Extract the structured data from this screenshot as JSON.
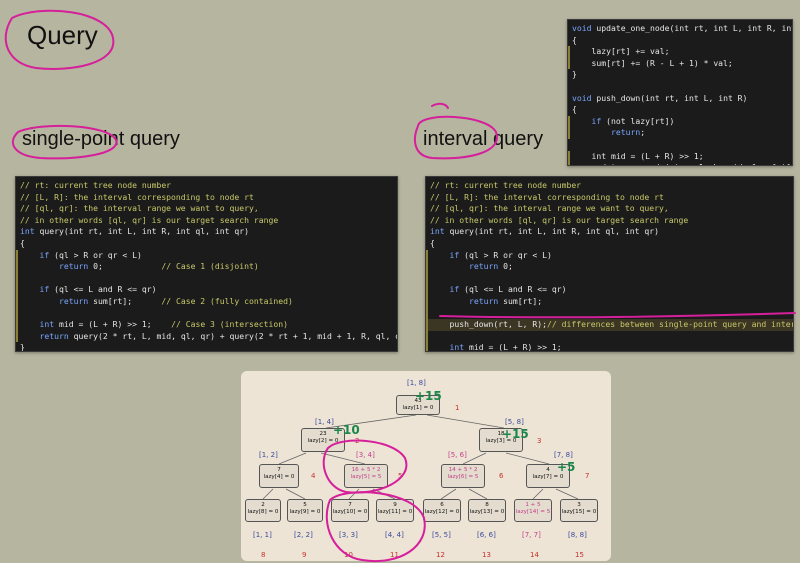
{
  "headings": {
    "main": "Query",
    "single_a": "single-point",
    "single_b": " query",
    "interval_a": "interval",
    "interval_b": " query"
  },
  "code_update": [
    [
      [
        "kw",
        "void"
      ],
      [
        "t",
        " update_one_node(int rt, int L, int R, int val)"
      ]
    ],
    [
      [
        "t",
        "{"
      ]
    ],
    [
      [
        "t",
        "    lazy[rt] += val;"
      ]
    ],
    [
      [
        "t",
        "    sum[rt] += (R - L + 1) * val;"
      ]
    ],
    [
      [
        "t",
        "}"
      ]
    ],
    [
      [
        "t",
        ""
      ]
    ],
    [
      [
        "kw",
        "void"
      ],
      [
        "t",
        " push_down(int rt, int L, int R)"
      ]
    ],
    [
      [
        "t",
        "{"
      ]
    ],
    [
      [
        "t",
        "    "
      ],
      [
        "kw",
        "if"
      ],
      [
        "t",
        " (not lazy[rt])"
      ]
    ],
    [
      [
        "t",
        "        "
      ],
      [
        "kw",
        "return"
      ],
      [
        "t",
        ";"
      ]
    ],
    [
      [
        "t",
        ""
      ]
    ],
    [
      [
        "t",
        "    int mid = (L + R) >> 1;"
      ]
    ],
    [
      [
        "t",
        "    update_one_node(rt << 1, L, mid, lazy[rt]);"
      ]
    ],
    [
      [
        "t",
        "    update_one_node((rt << 1) | 1, mid + 1, R, lazy[rt]);"
      ]
    ],
    [
      [
        "t",
        "    lazy[rt] = 0;"
      ]
    ],
    [
      [
        "t",
        "}"
      ]
    ]
  ],
  "code_single": [
    [
      [
        "com",
        "// rt: current tree node number"
      ]
    ],
    [
      [
        "com",
        "// [L, R]: the interval corresponding to node rt"
      ]
    ],
    [
      [
        "com",
        "// [ql, qr]: the interval range we want to query,"
      ]
    ],
    [
      [
        "com",
        "// in other words [ql, qr] is our target search range"
      ]
    ],
    [
      [
        "kw",
        "int"
      ],
      [
        "t",
        " query(int rt, int L, int R, int ql, int qr)"
      ]
    ],
    [
      [
        "t",
        "{"
      ]
    ],
    [
      [
        "t",
        "    "
      ],
      [
        "kw",
        "if"
      ],
      [
        "t",
        " (ql > R or qr < L)"
      ]
    ],
    [
      [
        "t",
        "        "
      ],
      [
        "kw",
        "return"
      ],
      [
        "t",
        " 0;            "
      ],
      [
        "com",
        "// Case 1 (disjoint)"
      ]
    ],
    [
      [
        "t",
        ""
      ]
    ],
    [
      [
        "t",
        "    "
      ],
      [
        "kw",
        "if"
      ],
      [
        "t",
        " (ql <= L and R <= qr)"
      ]
    ],
    [
      [
        "t",
        "        "
      ],
      [
        "kw",
        "return"
      ],
      [
        "t",
        " sum[rt];      "
      ],
      [
        "com",
        "// Case 2 (fully contained)"
      ]
    ],
    [
      [
        "t",
        ""
      ]
    ],
    [
      [
        "t",
        "    "
      ],
      [
        "kw",
        "int"
      ],
      [
        "t",
        " mid = (L + R) >> 1;    "
      ],
      [
        "com",
        "// Case 3 (intersection)"
      ]
    ],
    [
      [
        "t",
        "    "
      ],
      [
        "kw",
        "return"
      ],
      [
        "t",
        " query(2 * rt, L, mid, ql, qr) + query(2 * rt + 1, mid + 1, R, ql, qr);"
      ]
    ],
    [
      [
        "t",
        "}"
      ]
    ]
  ],
  "code_interval": [
    [
      [
        "com",
        "// rt: current tree node number"
      ]
    ],
    [
      [
        "com",
        "// [L, R]: the interval corresponding to node rt"
      ]
    ],
    [
      [
        "com",
        "// [ql, qr]: the interval range we want to query,"
      ]
    ],
    [
      [
        "com",
        "// in other words [ql, qr] is our target search range"
      ]
    ],
    [
      [
        "kw",
        "int"
      ],
      [
        "t",
        " query(int rt, int L, int R, int ql, int qr)"
      ]
    ],
    [
      [
        "t",
        "{"
      ]
    ],
    [
      [
        "t",
        "    "
      ],
      [
        "kw",
        "if"
      ],
      [
        "t",
        " (ql > R or qr < L)"
      ]
    ],
    [
      [
        "t",
        "        "
      ],
      [
        "kw",
        "return"
      ],
      [
        "t",
        " 0;"
      ]
    ],
    [
      [
        "t",
        ""
      ]
    ],
    [
      [
        "t",
        "    "
      ],
      [
        "kw",
        "if"
      ],
      [
        "t",
        " (ql <= L and R <= qr)"
      ]
    ],
    [
      [
        "t",
        "        "
      ],
      [
        "kw",
        "return"
      ],
      [
        "t",
        " sum[rt];"
      ]
    ],
    [
      [
        "t",
        ""
      ]
    ],
    [
      [
        "t",
        "    push_down(rt, L, R);"
      ],
      [
        "com",
        "// differences between single-point query and interval query"
      ]
    ],
    [
      [
        "t",
        ""
      ]
    ],
    [
      [
        "t",
        "    "
      ],
      [
        "kw",
        "int"
      ],
      [
        "t",
        " mid = (L + R) >> 1;"
      ]
    ],
    [
      [
        "t",
        "    "
      ],
      [
        "kw",
        "return"
      ],
      [
        "t",
        " query(rt << 1, L, mid, ql, qr) + query((rt << 1) | 1, mid + 1, R, ql, qr);"
      ]
    ],
    [
      [
        "t",
        "}"
      ]
    ]
  ],
  "tree": {
    "nodes": {
      "n1": [
        "43",
        "lazy[1] = 0"
      ],
      "n2": [
        "23",
        "lazy[2] = 0"
      ],
      "n3": [
        "18",
        "lazy[3] = 0"
      ],
      "n4": [
        "7",
        "lazy[4] = 0"
      ],
      "n5": [
        "16 + 5 * 2",
        "lazy[5] = 5"
      ],
      "n6": [
        "14 + 5 * 2",
        "lazy[6] = 5"
      ],
      "n7": [
        "4",
        "lazy[7] = 0"
      ],
      "n8": [
        "2",
        "lazy[8] = 0"
      ],
      "n9": [
        "5",
        "lazy[9] = 0"
      ],
      "n10": [
        "7",
        "lazy[10] = 0"
      ],
      "n11": [
        "9",
        "lazy[11] = 0"
      ],
      "n12": [
        "6",
        "lazy[12] = 0"
      ],
      "n13": [
        "8",
        "lazy[13] = 0"
      ],
      "n14": [
        "1 + 5",
        "lazy[14] = 5"
      ],
      "n15": [
        "3",
        "lazy[15] = 0"
      ]
    },
    "ranges": {
      "r1": "[1, 8]",
      "r2": "[1, 4]",
      "r3": "[5, 8]",
      "r4": "[1, 2]",
      "r5": "[3, 4]",
      "r6": "[5, 6]",
      "r7": "[7, 8]",
      "r8": "[1, 1]",
      "r9": "[2, 2]",
      "r10": "[3, 3]",
      "r11": "[4, 4]",
      "r12": "[5, 5]",
      "r13": "[6, 6]",
      "r14": "[7, 7]",
      "r15": "[8, 8]"
    },
    "ids": {
      "i1": "1",
      "i2": "2",
      "i3": "3",
      "i4": "4",
      "i5": "5",
      "i6": "6",
      "i7": "7",
      "i8": "8",
      "i9": "9",
      "i10": "10",
      "i11": "11",
      "i12": "12",
      "i13": "13",
      "i14": "14",
      "i15": "15"
    }
  },
  "annotations": {
    "a1": "+15",
    "a2": "+10",
    "a3": "+15",
    "a4": "+5"
  },
  "colors": {
    "background": "#b6b59f",
    "marker_magenta": "#d61f9b",
    "marker_green": "#19864a",
    "code_bg": "#1b1b1b",
    "comment": "#c9c96a",
    "keyword": "#7aa6ff",
    "tree_pink": "#c2408a",
    "tree_blue": "#3a4a9a",
    "tree_red": "#c7302c"
  }
}
